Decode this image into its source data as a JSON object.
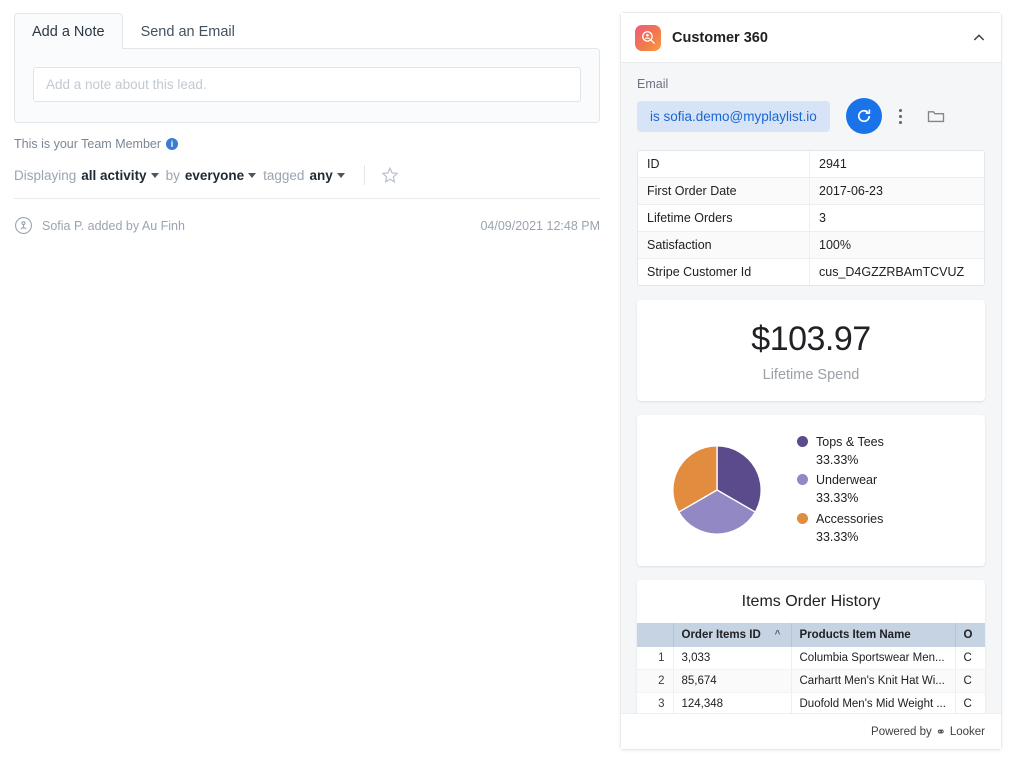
{
  "left": {
    "tabs": [
      {
        "label": "Add a Note",
        "active": true
      },
      {
        "label": "Send an Email",
        "active": false
      }
    ],
    "note_placeholder": "Add a note about this lead.",
    "note_value": "",
    "team_member_text": "This is your Team Member",
    "filter": {
      "prefix": "Displaying",
      "activity": "all activity",
      "by_label": "by",
      "by_value": "everyone",
      "tagged_label": "tagged",
      "tagged_value": "any"
    },
    "activity": [
      {
        "text": "Sofia P. added by Au Finh",
        "time": "04/09/2021 12:48 PM"
      }
    ]
  },
  "panel": {
    "title": "Customer 360",
    "email_label": "Email",
    "email_value": "is sofia.demo@myplaylist.io",
    "details": [
      {
        "key": "ID",
        "value": "2941"
      },
      {
        "key": "First Order Date",
        "value": "2017-06-23"
      },
      {
        "key": "Lifetime Orders",
        "value": "3"
      },
      {
        "key": "Satisfaction",
        "value": "100%"
      },
      {
        "key": "Stripe Customer Id",
        "value": "cus_D4GZZRBAmTCVUZ"
      }
    ],
    "spend": {
      "value": "$103.97",
      "label": "Lifetime Spend"
    },
    "table": {
      "title": "Items Order History",
      "headers": [
        "Order Items ID",
        "Products Item Name",
        "O"
      ],
      "rows": [
        {
          "idx": "1",
          "order_items_id": "3,033",
          "product": "Columbia Sportswear Men...",
          "extra": "C"
        },
        {
          "idx": "2",
          "order_items_id": "85,674",
          "product": "Carhartt Men's Knit Hat Wi...",
          "extra": "C"
        },
        {
          "idx": "3",
          "order_items_id": "124,348",
          "product": "Duofold Men's Mid Weight ...",
          "extra": "C"
        }
      ]
    },
    "footer": {
      "powered_by": "Powered by",
      "brand": "Looker"
    }
  },
  "chart_data": {
    "type": "pie",
    "title": "",
    "categories": [
      "Tops & Tees",
      "Underwear",
      "Accessories"
    ],
    "values": [
      33.33,
      33.33,
      33.33
    ],
    "labels": [
      "33.33%",
      "33.33%",
      "33.33%"
    ],
    "colors": [
      "#5B4A8C",
      "#9288C4",
      "#E28C3F"
    ],
    "legend_position": "right",
    "grid": false
  },
  "colors": {
    "accent_blue": "#1a73e8",
    "chip_bg": "#d7e4f7",
    "chip_text": "#1967d2",
    "table_header": "#c6d3e2",
    "panel_bg": "#f4f6f8"
  }
}
